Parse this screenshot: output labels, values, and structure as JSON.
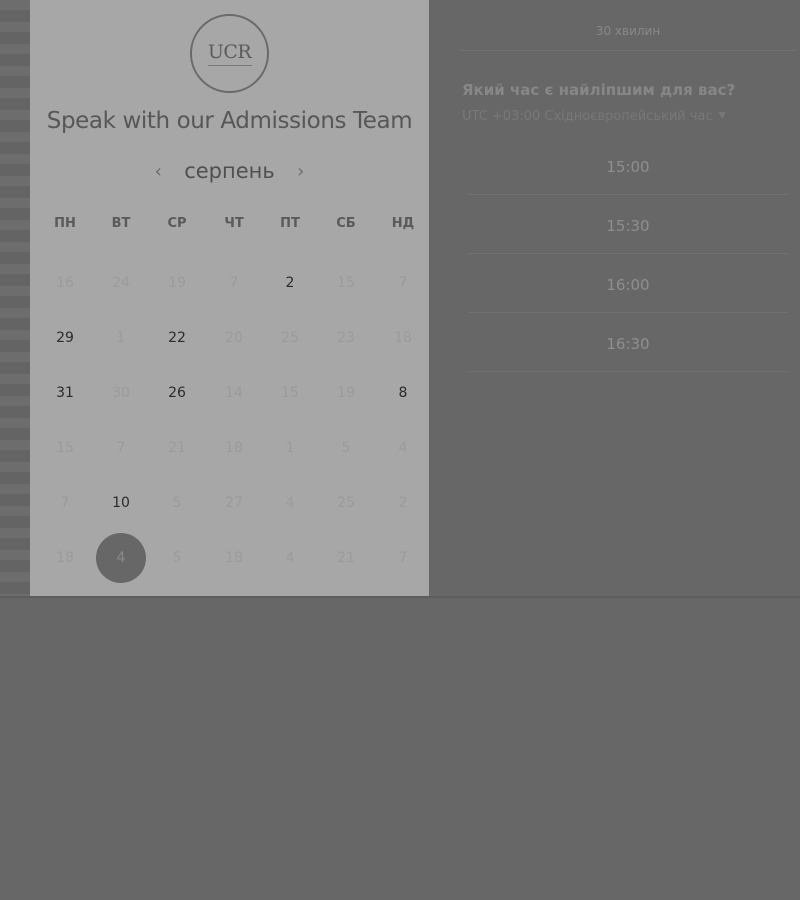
{
  "brand": {
    "logo_text": "UCR"
  },
  "panel": {
    "title": "Speak with our Admissions Team"
  },
  "calendar": {
    "month": "серпень",
    "prev_icon": "chevron-left-icon",
    "next_icon": "chevron-right-icon",
    "weekdays": [
      "ПН",
      "ВТ",
      "СР",
      "ЧТ",
      "ПТ",
      "СБ",
      "НД"
    ],
    "weeks": [
      [
        {
          "d": "16",
          "s": "inactive"
        },
        {
          "d": "24",
          "s": "inactive"
        },
        {
          "d": "19",
          "s": "inactive"
        },
        {
          "d": "7",
          "s": "inactive"
        },
        {
          "d": "2",
          "s": "active"
        },
        {
          "d": "15",
          "s": "inactive"
        },
        {
          "d": "7",
          "s": "inactive"
        }
      ],
      [
        {
          "d": "29",
          "s": "active"
        },
        {
          "d": "1",
          "s": "inactive"
        },
        {
          "d": "22",
          "s": "active"
        },
        {
          "d": "20",
          "s": "inactive"
        },
        {
          "d": "25",
          "s": "inactive"
        },
        {
          "d": "23",
          "s": "inactive"
        },
        {
          "d": "18",
          "s": "inactive"
        }
      ],
      [
        {
          "d": "31",
          "s": "active"
        },
        {
          "d": "30",
          "s": "inactive"
        },
        {
          "d": "26",
          "s": "active"
        },
        {
          "d": "14",
          "s": "inactive"
        },
        {
          "d": "15",
          "s": "inactive"
        },
        {
          "d": "19",
          "s": "inactive"
        },
        {
          "d": "8",
          "s": "active"
        }
      ],
      [
        {
          "d": "15",
          "s": "inactive"
        },
        {
          "d": "7",
          "s": "inactive"
        },
        {
          "d": "21",
          "s": "inactive"
        },
        {
          "d": "18",
          "s": "inactive"
        },
        {
          "d": "1",
          "s": "inactive"
        },
        {
          "d": "5",
          "s": "inactive"
        },
        {
          "d": "4",
          "s": "inactive"
        }
      ],
      [
        {
          "d": "7",
          "s": "inactive"
        },
        {
          "d": "10",
          "s": "active"
        },
        {
          "d": "5",
          "s": "inactive"
        },
        {
          "d": "27",
          "s": "inactive"
        },
        {
          "d": "4",
          "s": "inactive"
        },
        {
          "d": "25",
          "s": "inactive"
        },
        {
          "d": "2",
          "s": "inactive"
        }
      ],
      [
        {
          "d": "18",
          "s": "inactive"
        },
        {
          "d": "4",
          "s": "selected"
        },
        {
          "d": "5",
          "s": "inactive"
        },
        {
          "d": "18",
          "s": "inactive"
        },
        {
          "d": "4",
          "s": "inactive"
        },
        {
          "d": "21",
          "s": "inactive"
        },
        {
          "d": "7",
          "s": "inactive"
        }
      ]
    ]
  },
  "schedule": {
    "duration": "30 хвилин",
    "question": "Який час є найліпшим для вас?",
    "timezone": "UTC +03:00 Східноєвропейський час",
    "timezone_icon": "caret-down-icon",
    "slots": [
      "15:00",
      "15:30",
      "16:00",
      "16:30"
    ]
  }
}
